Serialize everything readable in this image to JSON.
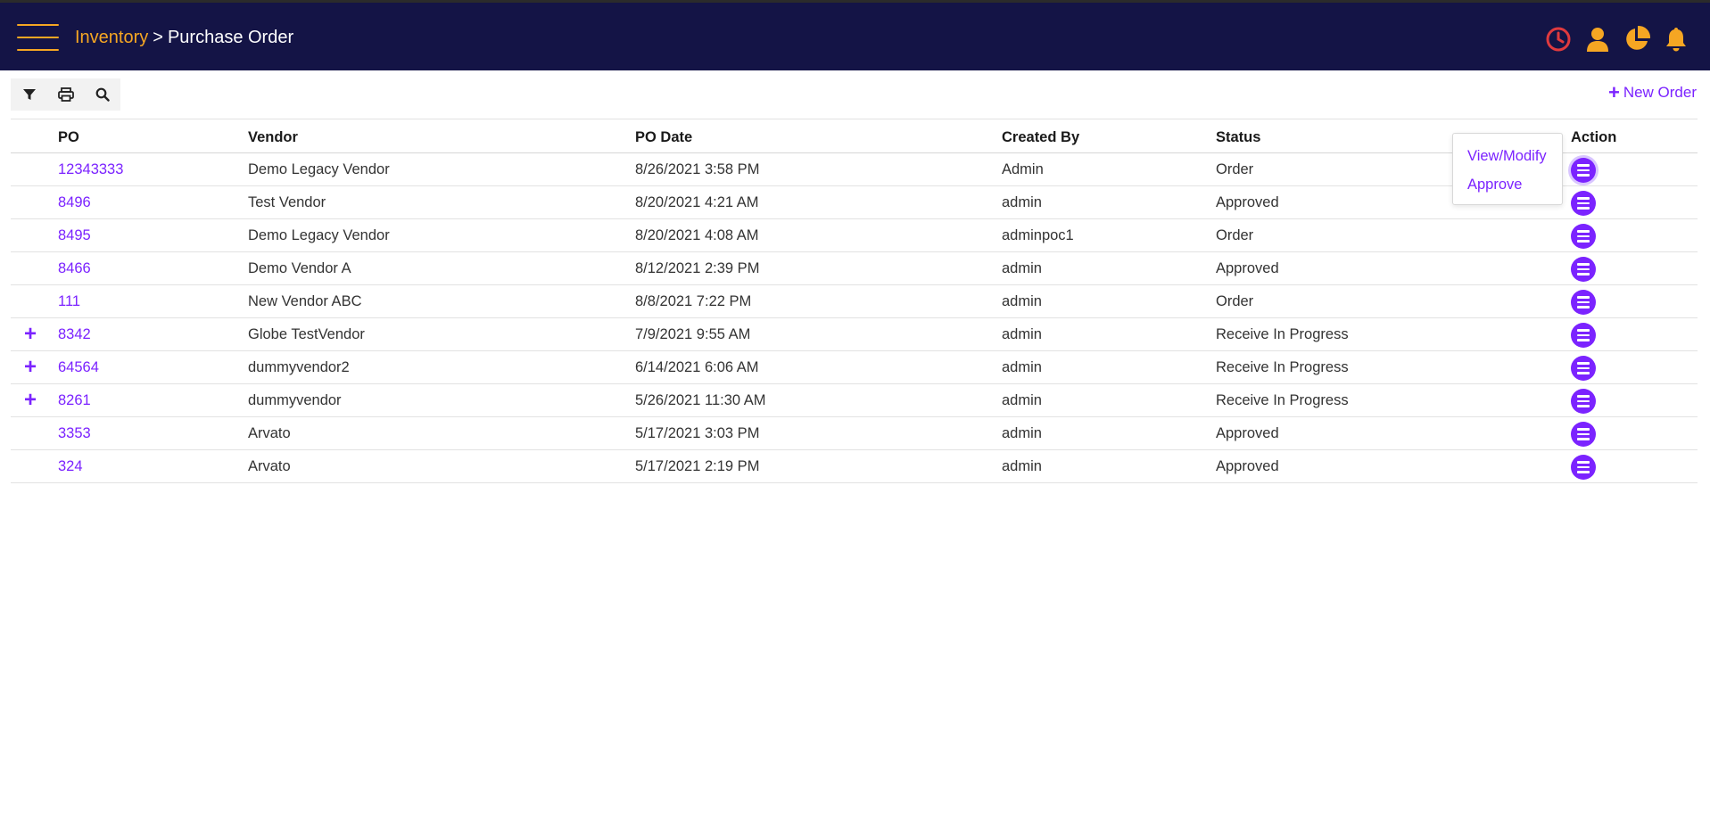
{
  "header": {
    "breadcrumb_parent": "Inventory",
    "breadcrumb_separator": ">",
    "breadcrumb_current": "Purchase Order",
    "icons": [
      "clock-icon",
      "user-icon",
      "pie-chart-icon",
      "bell-icon"
    ]
  },
  "toolbar": {
    "icons": [
      "filter-icon",
      "print-icon",
      "search-icon"
    ],
    "new_order_label": "New Order"
  },
  "table": {
    "columns": [
      "PO",
      "Vendor",
      "PO Date",
      "Created By",
      "Status",
      "Action"
    ],
    "rows": [
      {
        "expand": "",
        "po": "12343333",
        "vendor": "Demo Legacy Vendor",
        "date": "8/26/2021 3:58 PM",
        "created_by": "Admin",
        "status": "Order"
      },
      {
        "expand": "",
        "po": "8496",
        "vendor": "Test Vendor",
        "date": "8/20/2021 4:21 AM",
        "created_by": "admin",
        "status": "Approved"
      },
      {
        "expand": "",
        "po": "8495",
        "vendor": "Demo Legacy Vendor",
        "date": "8/20/2021 4:08 AM",
        "created_by": "adminpoc1",
        "status": "Order"
      },
      {
        "expand": "",
        "po": "8466",
        "vendor": "Demo Vendor A",
        "date": "8/12/2021 2:39 PM",
        "created_by": "admin",
        "status": "Approved"
      },
      {
        "expand": "",
        "po": "111",
        "vendor": "New Vendor ABC",
        "date": "8/8/2021 7:22 PM",
        "created_by": "admin",
        "status": "Order"
      },
      {
        "expand": "+",
        "po": "8342",
        "vendor": "Globe TestVendor",
        "date": "7/9/2021 9:55 AM",
        "created_by": "admin",
        "status": "Receive In Progress"
      },
      {
        "expand": "+",
        "po": "64564",
        "vendor": "dummyvendor2",
        "date": "6/14/2021 6:06 AM",
        "created_by": "admin",
        "status": "Receive In Progress"
      },
      {
        "expand": "+",
        "po": "8261",
        "vendor": "dummyvendor",
        "date": "5/26/2021 11:30 AM",
        "created_by": "admin",
        "status": "Receive In Progress"
      },
      {
        "expand": "",
        "po": "3353",
        "vendor": "Arvato",
        "date": "5/17/2021 3:03 PM",
        "created_by": "admin",
        "status": "Approved"
      },
      {
        "expand": "",
        "po": "324",
        "vendor": "Arvato",
        "date": "5/17/2021 2:19 PM",
        "created_by": "admin",
        "status": "Approved"
      }
    ]
  },
  "action_menu": {
    "items": [
      "View/Modify",
      "Approve"
    ]
  },
  "colors": {
    "header_bg": "#141446",
    "accent_orange": "#f5a623",
    "accent_purple": "#7b23ff",
    "clock_red": "#e03a3e"
  }
}
